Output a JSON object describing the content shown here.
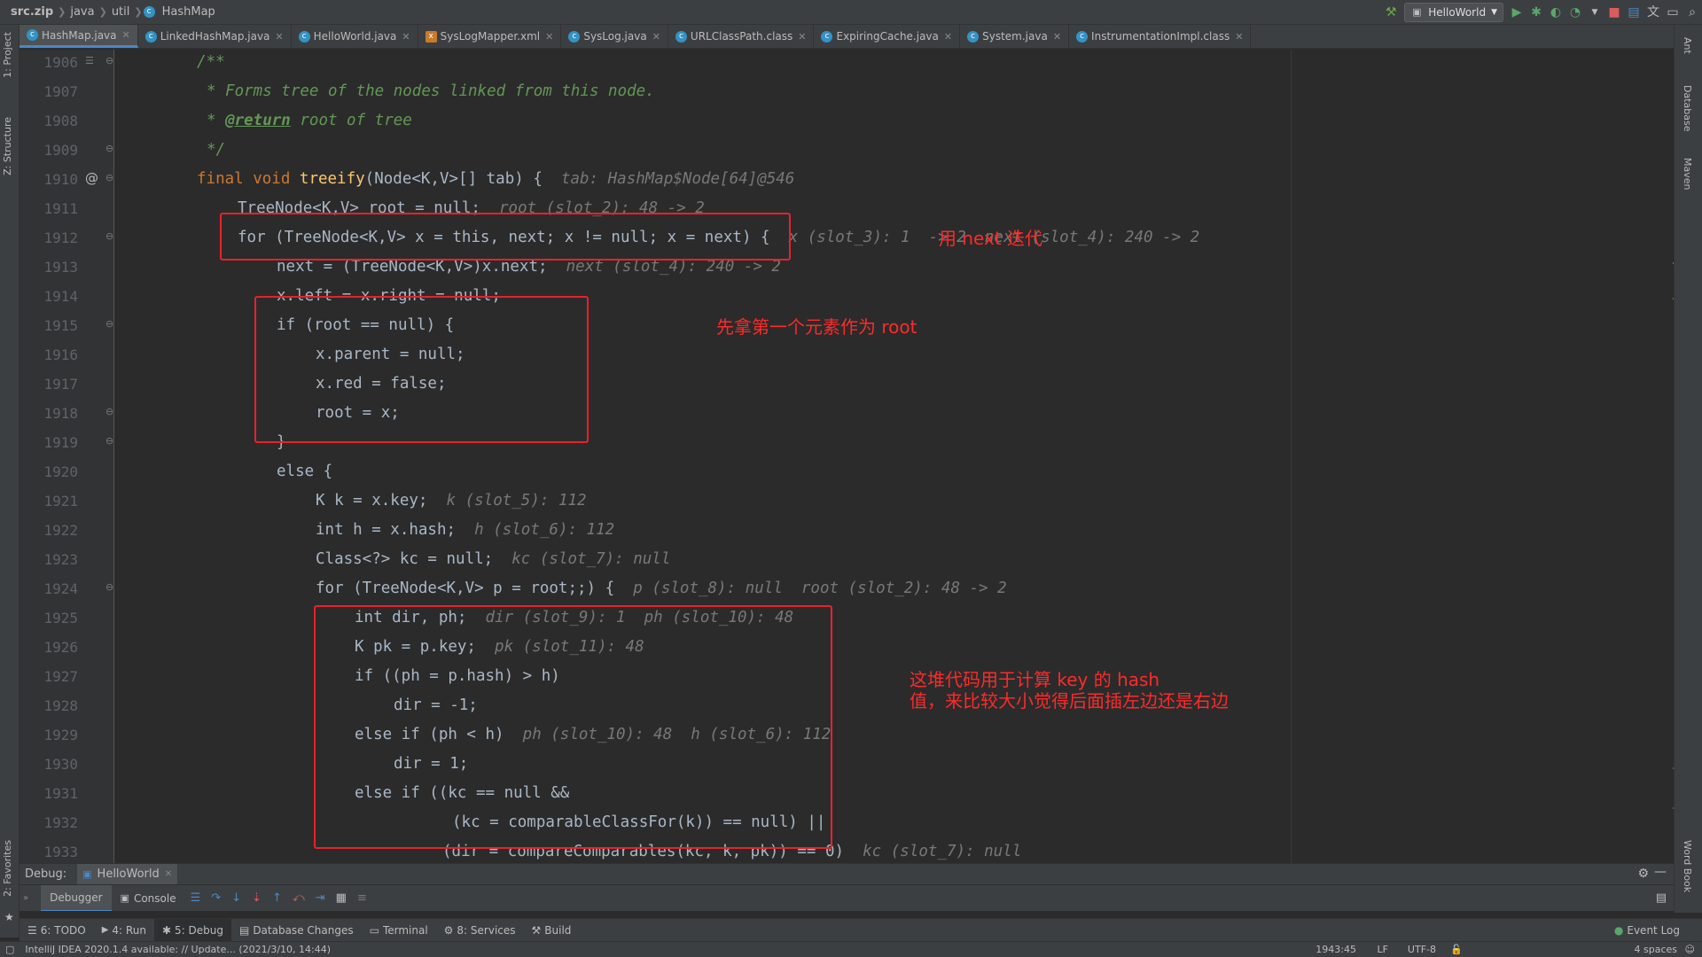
{
  "breadcrumb": {
    "items": [
      "src.zip",
      "java",
      "util",
      "HashMap"
    ]
  },
  "toolbar": {
    "run_config": "HelloWorld"
  },
  "tabs": [
    {
      "label": "HashMap.java",
      "icon": "class-icon",
      "active": true
    },
    {
      "label": "LinkedHashMap.java",
      "icon": "class-icon",
      "active": false
    },
    {
      "label": "HelloWorld.java",
      "icon": "class-icon",
      "active": false
    },
    {
      "label": "SysLogMapper.xml",
      "icon": "xml-icon",
      "active": false
    },
    {
      "label": "SysLog.java",
      "icon": "class-icon",
      "active": false
    },
    {
      "label": "URLClassPath.class",
      "icon": "class-icon",
      "active": false
    },
    {
      "label": "ExpiringCache.java",
      "icon": "class-icon",
      "active": false
    },
    {
      "label": "System.java",
      "icon": "class-icon",
      "active": false
    },
    {
      "label": "InstrumentationImpl.class",
      "icon": "class-icon",
      "active": false
    }
  ],
  "left_stripe": {
    "project": "1: Project",
    "structure": "Z: Structure",
    "favorites": "2: Favorites"
  },
  "right_stripe": {
    "ant": "Ant",
    "database": "Database",
    "maven": "Maven",
    "wordbook": "Word Book"
  },
  "code_lines": [
    {
      "num": "1906",
      "text": "/**"
    },
    {
      "num": "1907",
      "text": "* Forms tree of the nodes linked from this node."
    },
    {
      "num": "1908",
      "tag": "@return",
      "text": " root of tree"
    },
    {
      "num": "1909",
      "text": "*/"
    },
    {
      "num": "1910",
      "kw": "final void ",
      "fn": "treeify",
      "text": "(Node<K,V>[] tab) {",
      "hint": "tab: HashMap$Node[64]@546"
    },
    {
      "num": "1911",
      "text": "TreeNode<K,V> root = null;",
      "hint": "root (slot_2): 48 -> 2"
    },
    {
      "num": "1912",
      "text": "for (TreeNode<K,V> x = this, next; x != null; x = next) {",
      "hint": "x (slot_3): 1  -> 2  next (slot_4): 240 -> 2"
    },
    {
      "num": "1913",
      "text": "next = (TreeNode<K,V>)x.next;",
      "hint": "next (slot_4): 240 -> 2"
    },
    {
      "num": "1914",
      "text": "x.left = x.right = null;"
    },
    {
      "num": "1915",
      "text": "if (root == null) {"
    },
    {
      "num": "1916",
      "text": "x.parent = null;"
    },
    {
      "num": "1917",
      "text": "x.red = false;"
    },
    {
      "num": "1918",
      "text": "root = x;"
    },
    {
      "num": "1919",
      "text": "}"
    },
    {
      "num": "1920",
      "text": "else {"
    },
    {
      "num": "1921",
      "text": "K k = x.key;",
      "hint": "k (slot_5): 112"
    },
    {
      "num": "1922",
      "text": "int h = x.hash;",
      "hint": "h (slot_6): 112"
    },
    {
      "num": "1923",
      "text": "Class<?> kc = null;",
      "hint": "kc (slot_7): null"
    },
    {
      "num": "1924",
      "text": "for (TreeNode<K,V> p = root;;) {",
      "hint": "p (slot_8): null  root (slot_2): 48 -> 2"
    },
    {
      "num": "1925",
      "text": "int dir, ph;",
      "hint": "dir (slot_9): 1  ph (slot_10): 48"
    },
    {
      "num": "1926",
      "text": "K pk = p.key;",
      "hint": "pk (slot_11): 48"
    },
    {
      "num": "1927",
      "text": "if ((ph = p.hash) > h)"
    },
    {
      "num": "1928",
      "text": "dir = -1;"
    },
    {
      "num": "1929",
      "text": "else if (ph < h)",
      "hint": "ph (slot_10): 48  h (slot_6): 112"
    },
    {
      "num": "1930",
      "text": "dir = 1;"
    },
    {
      "num": "1931",
      "text": "else if ((kc == null &&"
    },
    {
      "num": "1932",
      "text": "(kc = comparableClassFor(k)) == null) ||"
    },
    {
      "num": "1933",
      "text": "(dir = compareComparables(kc, k, pk)) == 0)",
      "hint": "kc (slot_7): null"
    }
  ],
  "annotations": {
    "note1": "用 next 迭代",
    "note2": "先拿第一个元素作为 root",
    "note3_line1": "这堆代码用于计算 key 的 hash",
    "note3_line2": "值，来比较大小觉得后面插左边还是右边"
  },
  "debug": {
    "label": "Debug:",
    "session": "HelloWorld",
    "tabs": [
      "Debugger",
      "Console"
    ]
  },
  "tool_windows": [
    "6: TODO",
    "4: Run",
    "5: Debug",
    "Database Changes",
    "Terminal",
    "8: Services",
    "Build"
  ],
  "event_log": "Event Log",
  "status": {
    "message": "IntelliJ IDEA 2020.1.4 available: // Update... (2021/3/10, 14:44)",
    "position": "1943:45",
    "line_sep": "LF",
    "encoding": "UTF-8",
    "indent": "4 spaces"
  },
  "colors": {
    "accent": "#4a88c7",
    "annotation": "#e8212b",
    "keyword": "#cc7832",
    "comment": "#629755"
  }
}
